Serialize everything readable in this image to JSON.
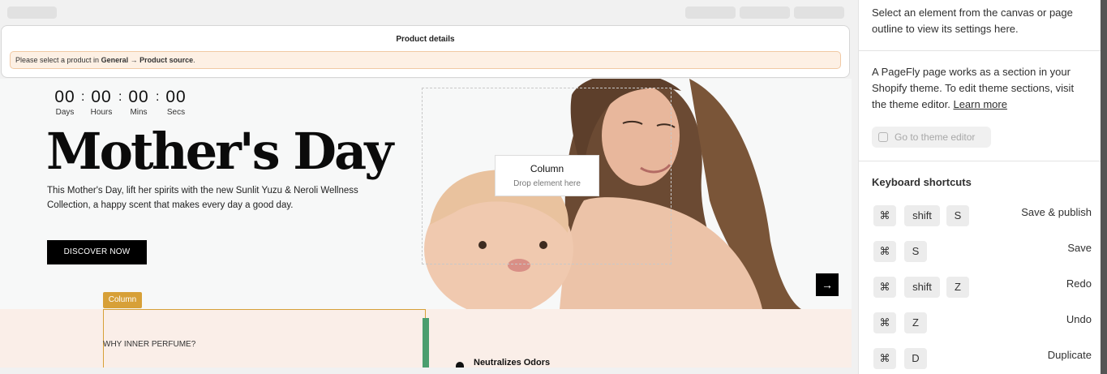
{
  "product_details": {
    "title": "Product details",
    "warning_prefix": "Please select a product in ",
    "warning_bold": "General → Product source",
    "warning_suffix": "."
  },
  "countdown": {
    "days": "00",
    "days_label": "Days",
    "hours": "00",
    "hours_label": "Hours",
    "mins": "00",
    "mins_label": "Mins",
    "secs": "00",
    "secs_label": "Secs",
    "separator": ":"
  },
  "hero": {
    "title": "Mother's Day",
    "text": "This Mother's Day, lift her spirits with the new Sunlit Yuzu & Neroli Wellness Collection, a happy scent that makes every day a good day.",
    "cta": "DISCOVER NOW",
    "next_arrow": "→"
  },
  "column_placeholder": {
    "title": "Column",
    "subtitle": "Drop element here"
  },
  "lower_section": {
    "column_tag": "Column",
    "why_heading": "WHY INNER PERFUME?",
    "feature_1": "Neutralizes Odors"
  },
  "sidebar": {
    "intro": "Select an element from the canvas or page outline to view its settings here.",
    "theme_text": "A PageFly page works as a section in your Shopify theme. To edit theme sections, visit the theme editor.",
    "learn_more": "Learn more",
    "theme_button": "Go to theme editor",
    "shortcuts_title": "Keyboard shortcuts",
    "shortcuts": [
      {
        "keys": [
          "⌘",
          "shift",
          "S"
        ],
        "label": "Save & publish"
      },
      {
        "keys": [
          "⌘",
          "S"
        ],
        "label": "Save"
      },
      {
        "keys": [
          "⌘",
          "shift",
          "Z"
        ],
        "label": "Redo"
      },
      {
        "keys": [
          "⌘",
          "Z"
        ],
        "label": "Undo"
      },
      {
        "keys": [
          "⌘",
          "D"
        ],
        "label": "Duplicate"
      }
    ]
  },
  "colors": {
    "accent_column": "#d7a038",
    "warning_bg": "#fdf0e4",
    "cta_bg": "#000000"
  }
}
